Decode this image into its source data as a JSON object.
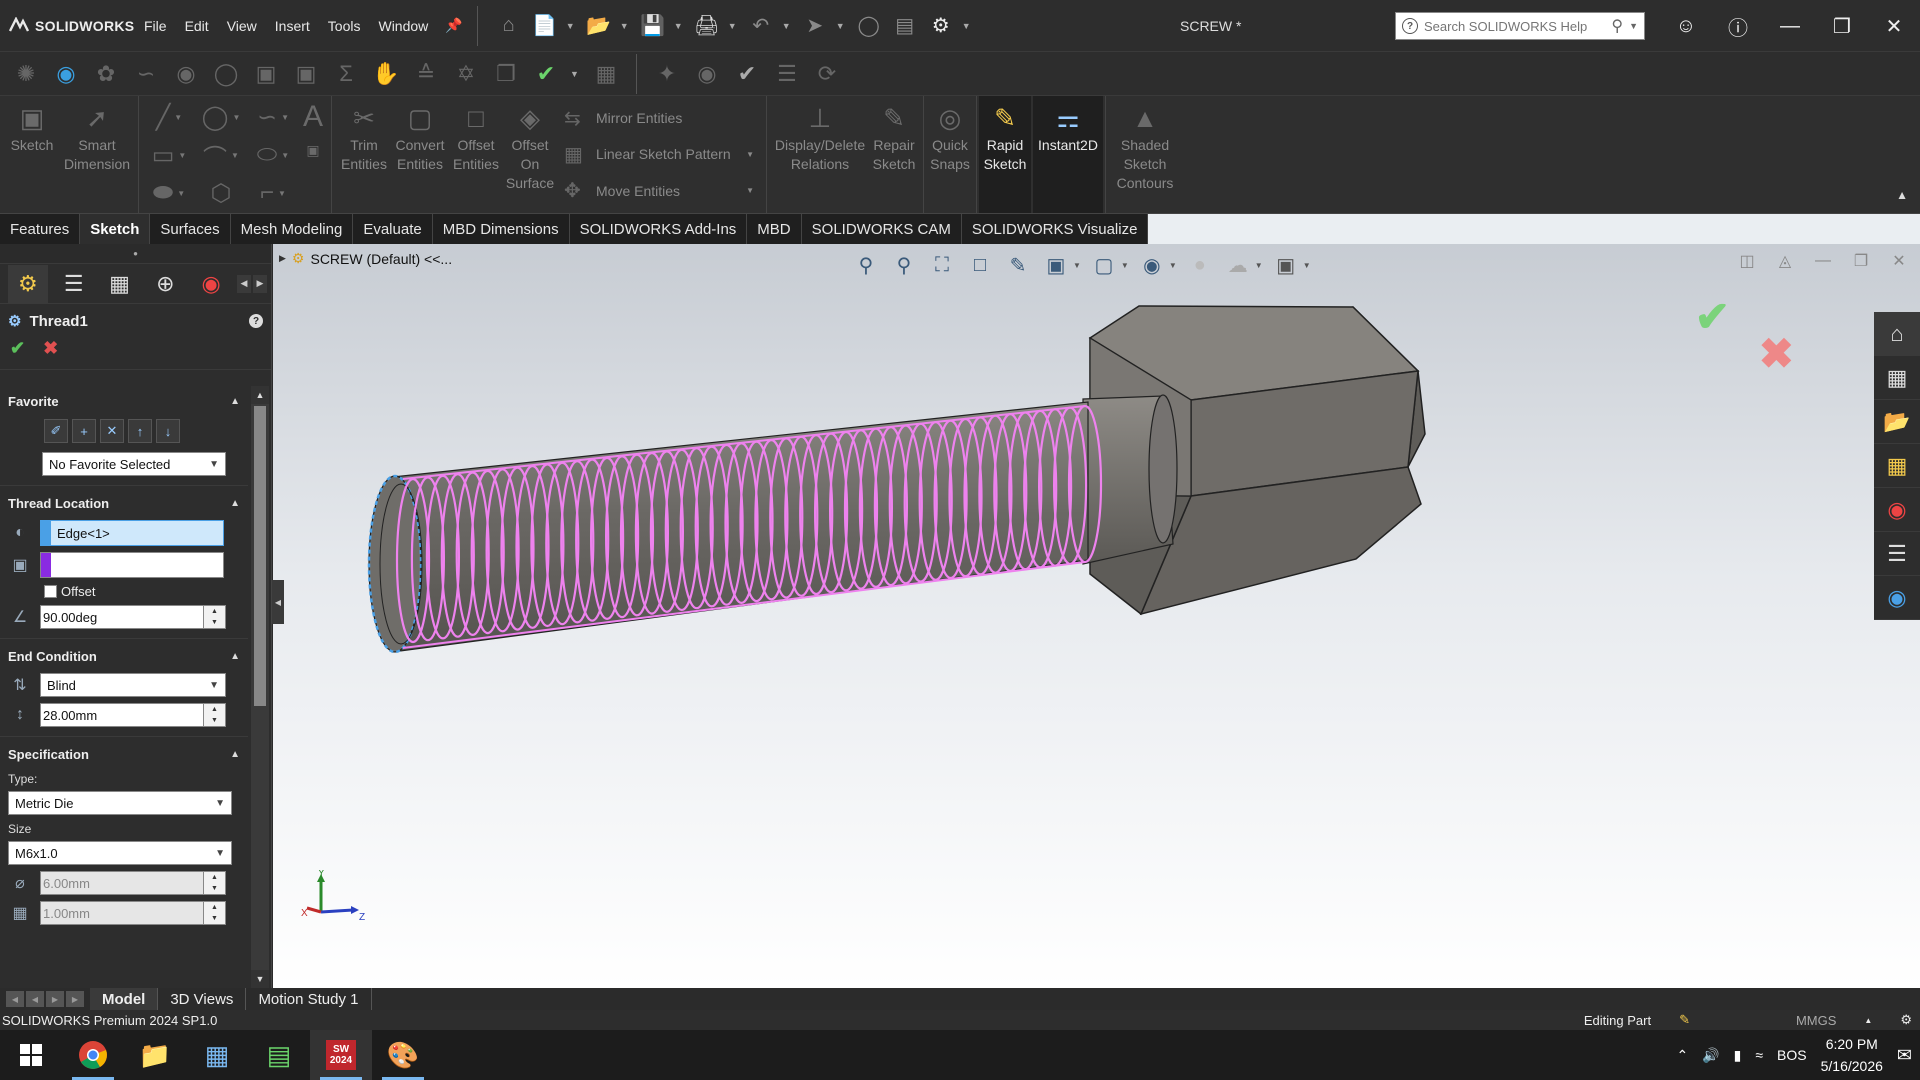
{
  "app": {
    "brand": "SOLIDWORKS",
    "document_title": "SCREW *",
    "search_placeholder": "Search SOLIDWORKS Help"
  },
  "menu": [
    "File",
    "Edit",
    "View",
    "Insert",
    "Tools",
    "Window"
  ],
  "ribbon": {
    "sketch": "Sketch",
    "smart_dimension": "Smart Dimension",
    "trim_entities": "Trim Entities",
    "convert_entities": "Convert Entities",
    "offset_entities": "Offset Entities",
    "offset_on_surface": "Offset On Surface",
    "mirror_entities": "Mirror Entities",
    "linear_sketch_pattern": "Linear Sketch Pattern",
    "move_entities": "Move Entities",
    "display_delete_relations": "Display/Delete Relations",
    "repair_sketch": "Repair Sketch",
    "quick_snaps": "Quick Snaps",
    "rapid_sketch": "Rapid Sketch",
    "instant2d": "Instant2D",
    "shaded_sketch_contours": "Shaded Sketch Contours"
  },
  "tabs": [
    "Features",
    "Sketch",
    "Surfaces",
    "Mesh Modeling",
    "Evaluate",
    "MBD Dimensions",
    "SOLIDWORKS Add-Ins",
    "MBD",
    "SOLIDWORKS CAM",
    "SOLIDWORKS Visualize"
  ],
  "active_tab": "Sketch",
  "property_manager": {
    "title": "Thread1",
    "favorite": {
      "header": "Favorite",
      "selected": "No Favorite Selected"
    },
    "thread_location": {
      "header": "Thread Location",
      "edge": "Edge<1>",
      "face": "",
      "offset_label": "Offset",
      "angle": "90.00deg"
    },
    "end_condition": {
      "header": "End Condition",
      "type": "Blind",
      "depth": "28.00mm"
    },
    "specification": {
      "header": "Specification",
      "type_label": "Type:",
      "type": "Metric Die",
      "size_label": "Size",
      "size": "M6x1.0",
      "diameter": "6.00mm",
      "pitch": "1.00mm"
    }
  },
  "graphics": {
    "tree_label": "SCREW (Default) <<..."
  },
  "bottom_tabs": [
    "Model",
    "3D Views",
    "Motion Study 1"
  ],
  "status": {
    "version": "SOLIDWORKS Premium 2024 SP1.0",
    "mode": "Editing Part",
    "units": "MMGS"
  },
  "taskbar": {
    "lang": "BOS",
    "time": "6:20 PM",
    "date": "5/16/2026",
    "sw_badge": "2024"
  },
  "colors": {
    "thread": "#ee82ee",
    "accent": "#4aa0e6",
    "ok": "#5bbf5b",
    "cancel": "#e05050"
  }
}
